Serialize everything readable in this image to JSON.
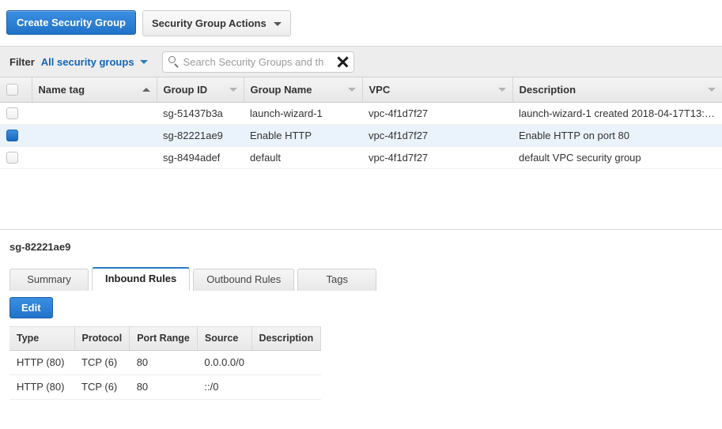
{
  "toolbar": {
    "create_button": "Create Security Group",
    "actions_button": "Security Group Actions"
  },
  "filterbar": {
    "label": "Filter",
    "selected_filter": "All security groups",
    "search_placeholder": "Search Security Groups and th",
    "search_value": ""
  },
  "list": {
    "columns": [
      {
        "key": "name",
        "label": "Name tag",
        "sort": "asc"
      },
      {
        "key": "gid",
        "label": "Group ID",
        "sort": "none"
      },
      {
        "key": "gname",
        "label": "Group Name",
        "sort": "none"
      },
      {
        "key": "vpc",
        "label": "VPC",
        "sort": "none"
      },
      {
        "key": "desc",
        "label": "Description",
        "sort": "none"
      }
    ],
    "rows": [
      {
        "selected": false,
        "name": "",
        "gid": "sg-51437b3a",
        "gname": "launch-wizard-1",
        "vpc": "vpc-4f1d7f27",
        "desc": "launch-wizard-1 created 2018-04-17T13:…"
      },
      {
        "selected": true,
        "name": "",
        "gid": "sg-82221ae9",
        "gname": "Enable HTTP",
        "vpc": "vpc-4f1d7f27",
        "desc": "Enable HTTP on port 80"
      },
      {
        "selected": false,
        "name": "",
        "gid": "sg-8494adef",
        "gname": "default",
        "vpc": "vpc-4f1d7f27",
        "desc": "default VPC security group"
      }
    ]
  },
  "detail": {
    "title": "sg-82221ae9",
    "tabs": [
      {
        "label": "Summary",
        "active": false
      },
      {
        "label": "Inbound Rules",
        "active": true
      },
      {
        "label": "Outbound Rules",
        "active": false
      },
      {
        "label": "Tags",
        "active": false
      }
    ],
    "edit_button": "Edit",
    "rules_columns": [
      "Type",
      "Protocol",
      "Port Range",
      "Source",
      "Description"
    ],
    "rules_rows": [
      {
        "type": "HTTP (80)",
        "protocol": "TCP (6)",
        "port": "80",
        "source": "0.0.0.0/0",
        "description": ""
      },
      {
        "type": "HTTP (80)",
        "protocol": "TCP (6)",
        "port": "80",
        "source": "::/0",
        "description": ""
      }
    ]
  },
  "colors": {
    "primary_blue": "#2173c9",
    "link_blue": "#1166bb",
    "selected_row": "#eaf2fc",
    "active_tab_border": "#2a7ac4"
  }
}
